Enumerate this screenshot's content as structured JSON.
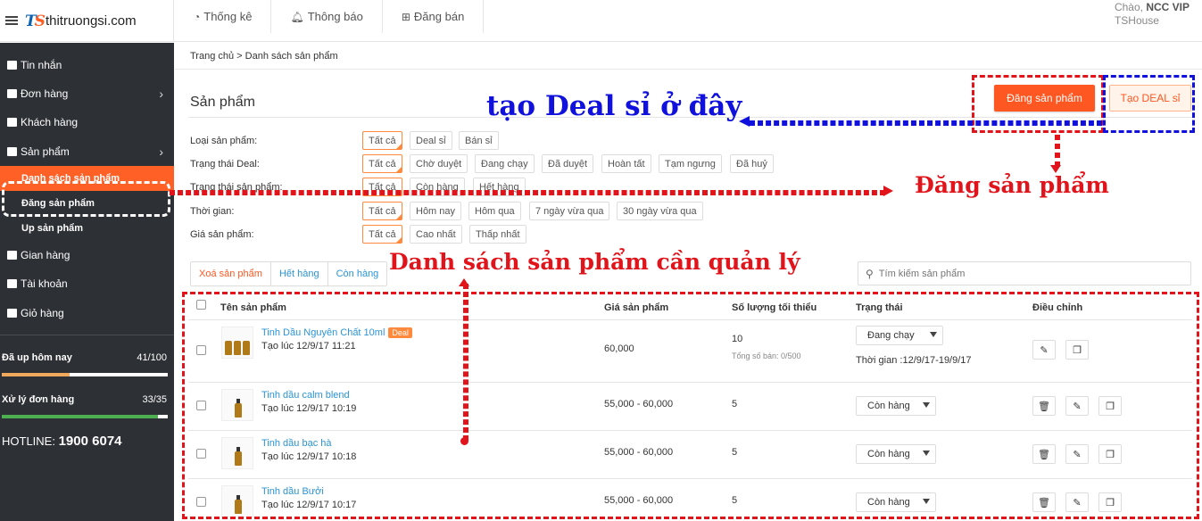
{
  "brand": {
    "logo_mark_1": "T",
    "logo_mark_2": "S",
    "name": "thitruongsi.com"
  },
  "topnav": [
    {
      "label": "Thống kê",
      "icon": "pie-chart-icon"
    },
    {
      "label": "Thông báo",
      "icon": "bell-icon"
    },
    {
      "label": "Đăng bán",
      "icon": "plus-square-icon"
    }
  ],
  "user": {
    "greeting": "Chào,",
    "name": "NCC VIP",
    "shop": "TSHouse"
  },
  "sidebar": {
    "items": [
      {
        "label": "Tin nhắn",
        "icon": "message-icon"
      },
      {
        "label": "Đơn hàng",
        "icon": "file-icon",
        "chevron": "›"
      },
      {
        "label": "Khách hàng",
        "icon": "contacts-icon"
      },
      {
        "label": "Sản phẩm",
        "icon": "box-icon",
        "chevron": "›"
      }
    ],
    "subitems": [
      {
        "label": "Danh sách sản phẩm",
        "active": true
      },
      {
        "label": "Đăng sản phẩm"
      },
      {
        "label": "Up sản phẩm"
      }
    ],
    "items2": [
      {
        "label": "Gian hàng",
        "icon": "store-icon"
      },
      {
        "label": "Tài khoản",
        "icon": "user-icon"
      },
      {
        "label": "Giỏ hàng",
        "icon": "cart-icon"
      }
    ],
    "stats": [
      {
        "label": "Đã up hôm nay",
        "value": "41/100",
        "progress": 0.41,
        "color": "#f0a95c"
      },
      {
        "label": "Xử lý đơn hàng",
        "value": "33/35",
        "progress": 0.943,
        "color": "#4caf50"
      }
    ],
    "hotline_label": "HOTLINE:",
    "hotline_number": "1900 6074"
  },
  "breadcrumb": "Trang chủ > Danh sách sản phẩm",
  "page_title": "Sản phẩm",
  "buttons": {
    "post_product": "Đăng sản phẩm",
    "create_deal": "Tạo DEAL sỉ"
  },
  "filters": [
    {
      "label": "Loại sản phẩm:",
      "options": [
        "Tất cả",
        "Deal sỉ",
        "Bán sỉ"
      ]
    },
    {
      "label": "Trạng thái Deal:",
      "options": [
        "Tất cả",
        "Chờ duyệt",
        "Đang chạy",
        "Đã duyệt",
        "Hoàn tất",
        "Tạm ngưng",
        "Đã huỷ"
      ]
    },
    {
      "label": "Trạng thái sản phẩm:",
      "options": [
        "Tất cả",
        "Còn hàng",
        "Hết hàng"
      ]
    },
    {
      "label": "Thời gian:",
      "options": [
        "Tất cả",
        "Hôm nay",
        "Hôm qua",
        "7 ngày vừa qua",
        "30 ngày vừa qua"
      ]
    },
    {
      "label": "Giá sản phẩm:",
      "options": [
        "Tất cả",
        "Cao nhất",
        "Thấp nhất"
      ]
    }
  ],
  "tabs": [
    "Xoá sản phẩm",
    "Hết hàng",
    "Còn hàng"
  ],
  "search": {
    "placeholder": "Tím kiếm sản phẩm"
  },
  "table": {
    "headers": [
      "Tên sản phẩm",
      "Giá sản phẩm",
      "Số lượng tối thiểu",
      "Trạng thái",
      "Điều chỉnh"
    ],
    "rows": [
      {
        "name": "Tinh Dầu Nguyên Chất 10ml",
        "badge": "Deal",
        "created": "Tạo lúc 12/9/17 11:21",
        "price": "60,000",
        "min_qty": "10",
        "sold": "Tổng số bán:  0/500",
        "status": "Đang chạy",
        "period": "Thời gian :12/9/17-19/9/17"
      },
      {
        "name": "Tinh dầu calm blend",
        "created": "Tạo lúc 12/9/17 10:19",
        "price": "55,000 - 60,000",
        "min_qty": "5",
        "status": "Còn hàng"
      },
      {
        "name": "Tinh dầu bạc hà",
        "created": "Tạo lúc 12/9/17 10:18",
        "price": "55,000 - 60,000",
        "min_qty": "5",
        "status": "Còn hàng"
      },
      {
        "name": "Tinh dầu Bưởi",
        "created": "Tạo lúc 12/9/17 10:17",
        "price": "55,000 - 60,000",
        "min_qty": "5",
        "status": "Còn hàng"
      }
    ]
  },
  "annotations": {
    "create_deal_here": "tạo Deal sỉ ở đây",
    "post_product": "Đăng sản phẩm",
    "product_list": "Danh sách sản phẩm cần quản lý"
  },
  "colors": {
    "accent": "#ff5722",
    "sidebar_bg": "#2d3035",
    "link": "#2a94d6",
    "annot_blue": "#1111dd",
    "annot_red": "#e0141a"
  }
}
